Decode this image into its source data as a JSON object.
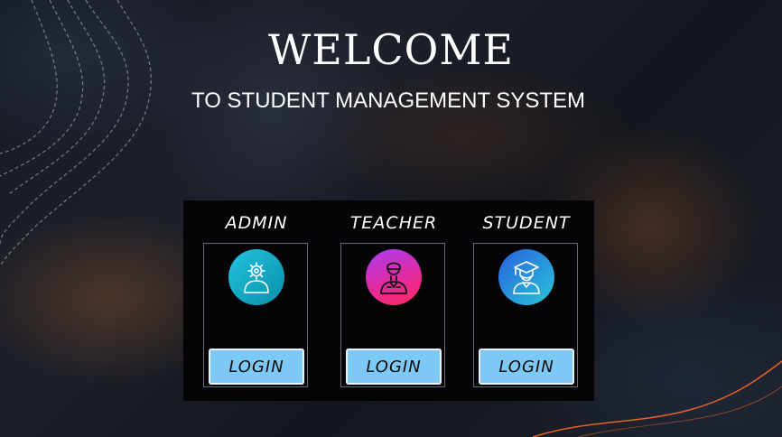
{
  "header": {
    "title": "WELCOME",
    "subtitle": "TO STUDENT MANAGEMENT SYSTEM"
  },
  "roles": [
    {
      "title": "ADMIN",
      "icon": "admin-gear-user-icon",
      "login_label": "LOGIN",
      "avatar_gradient": [
        "#1fb8d6",
        "#0a8fa8"
      ]
    },
    {
      "title": "TEACHER",
      "icon": "teacher-user-icon",
      "login_label": "LOGIN",
      "avatar_gradient": [
        "#b23cf0",
        "#ff2a6d"
      ]
    },
    {
      "title": "STUDENT",
      "icon": "graduate-user-icon",
      "login_label": "LOGIN",
      "avatar_gradient": [
        "#2f6fe0",
        "#27c7d6"
      ]
    }
  ],
  "colors": {
    "panel_bg": "#050507",
    "button_bg": "#7ec8f5",
    "text": "#ffffff",
    "accent_line": "#e8612c"
  }
}
